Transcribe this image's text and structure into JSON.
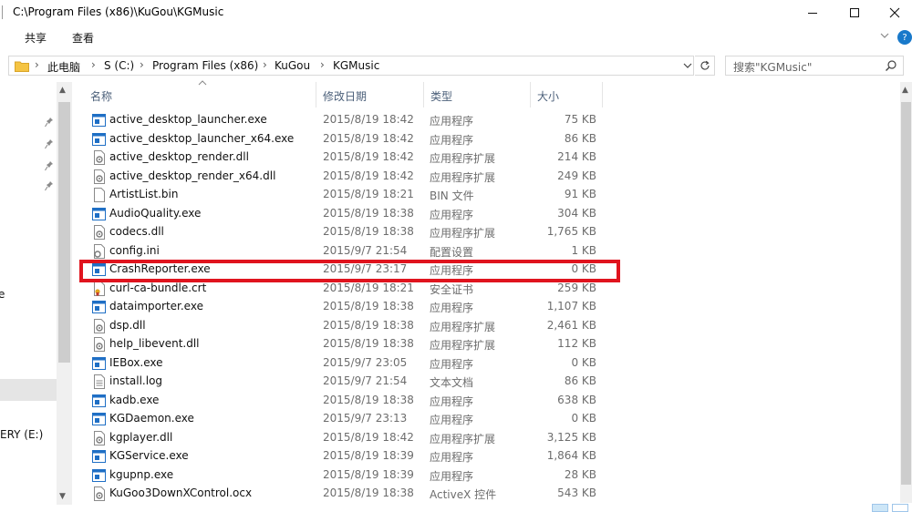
{
  "window": {
    "title": "C:\\Program Files (x86)\\KuGou\\KGMusic",
    "minimize_icon": "minimize-icon",
    "maximize_icon": "maximize-icon",
    "close_icon": "close-icon"
  },
  "ribbon": {
    "tabs": [
      "共享",
      "查看"
    ],
    "expand_icon": "chevron-down-icon",
    "help_icon": "help-icon",
    "help_label": "?"
  },
  "address": {
    "up_separator": "›",
    "crumbs": [
      "此电脑",
      "S (C:)",
      "Program Files (x86)",
      "KuGou",
      "KGMusic"
    ],
    "separator": "›",
    "dropdown_icon": "chevron-down-icon",
    "refresh_icon": "refresh-icon"
  },
  "search": {
    "placeholder": "搜索\"KGMusic\"",
    "icon": "search-icon"
  },
  "nav": {
    "partial_label": "e",
    "drive_label": "ERY (E:)"
  },
  "columns": {
    "name": "名称",
    "date": "修改日期",
    "type": "类型",
    "size": "大小"
  },
  "files": [
    {
      "name": "active_desktop_launcher.exe",
      "date": "2015/8/19 18:42",
      "type": "应用程序",
      "size": "75 KB",
      "icon": "exe"
    },
    {
      "name": "active_desktop_launcher_x64.exe",
      "date": "2015/8/19 18:42",
      "type": "应用程序",
      "size": "86 KB",
      "icon": "exe"
    },
    {
      "name": "active_desktop_render.dll",
      "date": "2015/8/19 18:42",
      "type": "应用程序扩展",
      "size": "214 KB",
      "icon": "dll"
    },
    {
      "name": "active_desktop_render_x64.dll",
      "date": "2015/8/19 18:42",
      "type": "应用程序扩展",
      "size": "249 KB",
      "icon": "dll"
    },
    {
      "name": "ArtistList.bin",
      "date": "2015/8/19 18:21",
      "type": "BIN 文件",
      "size": "91 KB",
      "icon": "file"
    },
    {
      "name": "AudioQuality.exe",
      "date": "2015/8/19 18:38",
      "type": "应用程序",
      "size": "304 KB",
      "icon": "exe"
    },
    {
      "name": "codecs.dll",
      "date": "2015/8/19 18:38",
      "type": "应用程序扩展",
      "size": "1,765 KB",
      "icon": "dll"
    },
    {
      "name": "config.ini",
      "date": "2015/9/7 21:54",
      "type": "配置设置",
      "size": "1 KB",
      "icon": "ini"
    },
    {
      "name": "CrashReporter.exe",
      "date": "2015/9/7 23:17",
      "type": "应用程序",
      "size": "0 KB",
      "icon": "exe"
    },
    {
      "name": "curl-ca-bundle.crt",
      "date": "2015/8/19 18:21",
      "type": "安全证书",
      "size": "259 KB",
      "icon": "crt"
    },
    {
      "name": "dataimporter.exe",
      "date": "2015/8/19 18:38",
      "type": "应用程序",
      "size": "1,107 KB",
      "icon": "exe"
    },
    {
      "name": "dsp.dll",
      "date": "2015/8/19 18:38",
      "type": "应用程序扩展",
      "size": "2,461 KB",
      "icon": "dll"
    },
    {
      "name": "help_libevent.dll",
      "date": "2015/8/19 18:38",
      "type": "应用程序扩展",
      "size": "112 KB",
      "icon": "dll"
    },
    {
      "name": "IEBox.exe",
      "date": "2015/9/7 23:05",
      "type": "应用程序",
      "size": "0 KB",
      "icon": "exe"
    },
    {
      "name": "install.log",
      "date": "2015/9/7 21:54",
      "type": "文本文档",
      "size": "86 KB",
      "icon": "txt"
    },
    {
      "name": "kadb.exe",
      "date": "2015/8/19 18:38",
      "type": "应用程序",
      "size": "638 KB",
      "icon": "exe"
    },
    {
      "name": "KGDaemon.exe",
      "date": "2015/9/7 23:13",
      "type": "应用程序",
      "size": "0 KB",
      "icon": "exe"
    },
    {
      "name": "kgplayer.dll",
      "date": "2015/8/19 18:42",
      "type": "应用程序扩展",
      "size": "3,125 KB",
      "icon": "dll"
    },
    {
      "name": "KGService.exe",
      "date": "2015/8/19 18:39",
      "type": "应用程序",
      "size": "1,864 KB",
      "icon": "exe"
    },
    {
      "name": "kgupnp.exe",
      "date": "2015/8/19 18:39",
      "type": "应用程序",
      "size": "28 KB",
      "icon": "exe"
    },
    {
      "name": "KuGoo3DownXControl.ocx",
      "date": "2015/8/19 18:38",
      "type": "ActiveX 控件",
      "size": "543 KB",
      "icon": "dll"
    }
  ],
  "highlighted_file": "CrashReporter.exe",
  "colors": {
    "highlight_border": "#e0141e",
    "exe_icon": "#1f6fc5",
    "header_text": "#4c607a",
    "folder": "#f5c443"
  }
}
